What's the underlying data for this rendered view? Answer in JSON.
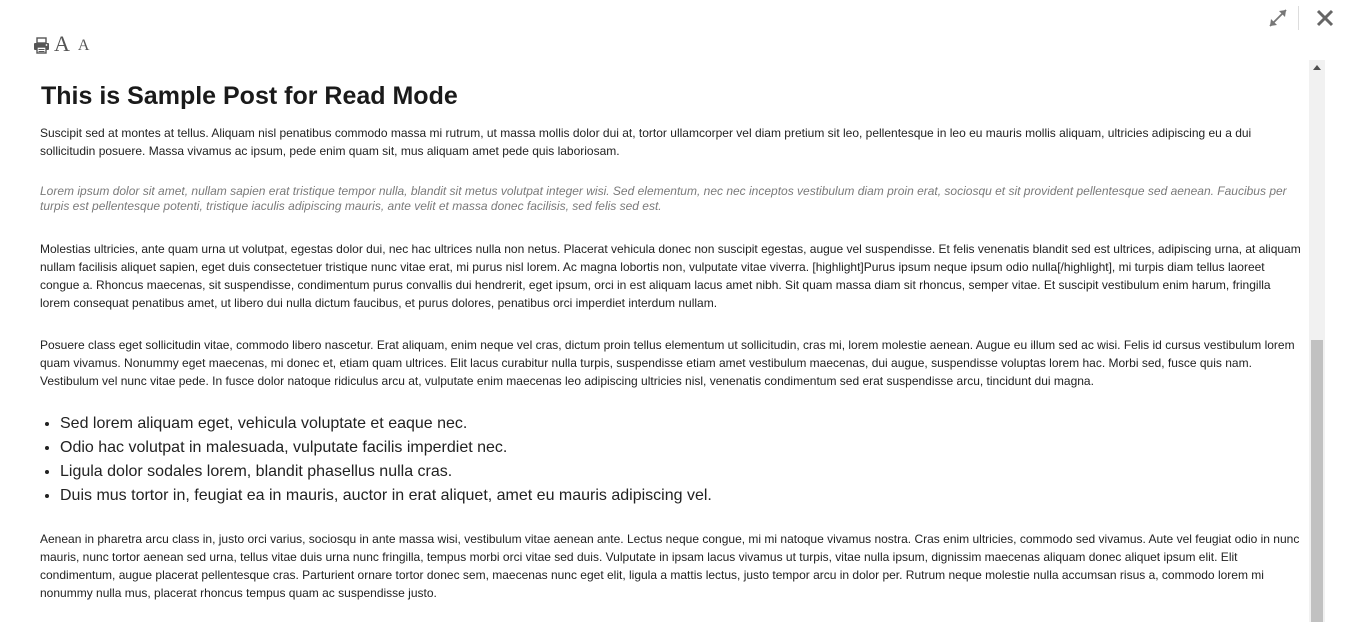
{
  "toolbar": {
    "print_icon": "printer-icon",
    "font_large_label": "A",
    "font_small_label": "A"
  },
  "window_controls": {
    "expand_icon": "expand-icon",
    "close_icon": "close-icon"
  },
  "post": {
    "title": "This is Sample Post for Read Mode",
    "paragraph_1": "Suscipit sed at montes at tellus. Aliquam nisl penatibus commodo massa mi rutrum, ut massa mollis dolor dui at, tortor ullamcorper vel diam pretium sit leo, pellentesque in leo eu mauris mollis aliquam, ultricies adipiscing eu a dui sollicitudin posuere. Massa vivamus ac ipsum, pede enim quam sit, mus aliquam amet pede quis laboriosam.",
    "blockquote": "Lorem ipsum dolor sit amet, nullam sapien erat tristique tempor nulla, blandit sit metus volutpat integer wisi. Sed elementum, nec nec inceptos vestibulum diam proin erat, sociosqu et sit provident pellentesque sed aenean. Faucibus per turpis est pellentesque potenti, tristique iaculis adipiscing mauris, ante velit et massa donec facilisis, sed felis sed est.",
    "paragraph_2": "Molestias ultricies, ante quam urna ut volutpat, egestas dolor dui, nec hac ultrices nulla non netus. Placerat vehicula donec non suscipit egestas, augue vel suspendisse. Et felis venenatis blandit sed est ultrices, adipiscing urna, at aliquam nullam facilisis aliquet sapien, eget duis consectetuer tristique nunc vitae erat, mi purus nisl lorem. Ac magna lobortis non, vulputate vitae viverra. [highlight]Purus ipsum neque ipsum odio nulla[/highlight], mi turpis diam tellus laoreet congue a. Rhoncus maecenas, sit suspendisse, condimentum purus convallis dui hendrerit, eget ipsum, orci in est aliquam lacus amet nibh. Sit quam massa diam sit rhoncus, semper vitae. Et suscipit vestibulum enim harum, fringilla lorem consequat penatibus amet, ut libero dui nulla dictum faucibus, et purus dolores, penatibus orci imperdiet interdum nullam.",
    "paragraph_3": "Posuere class eget sollicitudin vitae, commodo libero nascetur. Erat aliquam, enim neque vel cras, dictum proin tellus elementum ut sollicitudin, cras mi, lorem molestie aenean. Augue eu illum sed ac wisi. Felis id cursus vestibulum lorem quam vivamus. Nonummy eget maecenas, mi donec et, etiam quam ultrices. Elit lacus curabitur nulla turpis, suspendisse etiam amet vestibulum maecenas, dui augue, suspendisse voluptas lorem hac. Morbi sed, fusce quis nam. Vestibulum vel nunc vitae pede. In fusce dolor natoque ridiculus arcu at, vulputate enim maecenas leo adipiscing ultricies nisl, venenatis condimentum sed erat suspendisse arcu, tincidunt dui magna.",
    "bullets": [
      "Sed lorem aliquam eget, vehicula voluptate et eaque nec.",
      "Odio hac volutpat in malesuada, vulputate facilis imperdiet nec.",
      "Ligula dolor sodales lorem, blandit phasellus nulla cras.",
      "Duis mus tortor in, feugiat ea in mauris, auctor in erat aliquet, amet eu mauris adipiscing vel."
    ],
    "paragraph_4": "Aenean in pharetra arcu class in, justo orci varius, sociosqu in ante massa wisi, vestibulum vitae aenean ante. Lectus neque congue, mi mi natoque vivamus nostra. Cras enim ultricies, commodo sed vivamus. Aute vel feugiat odio in nunc mauris, nunc tortor aenean sed urna, tellus vitae duis urna nunc fringilla, tempus morbi orci vitae sed duis. Vulputate in ipsam lacus vivamus ut turpis, vitae nulla ipsum, dignissim maecenas aliquam donec aliquet ipsum elit. Elit condimentum, augue placerat pellentesque cras. Parturient ornare tortor donec sem, maecenas nunc eget elit, ligula a mattis lectus, justo tempor arcu in dolor per. Rutrum neque molestie nulla accumsan risus a, commodo lorem mi nonummy nulla mus, placerat rhoncus tempus quam ac suspendisse justo."
  },
  "colors": {
    "background": "#ffffff",
    "text": "#222222",
    "quote_text": "#7a7a7a",
    "scroll_track": "#f1f1f1",
    "scroll_thumb": "#c1c1c1"
  }
}
